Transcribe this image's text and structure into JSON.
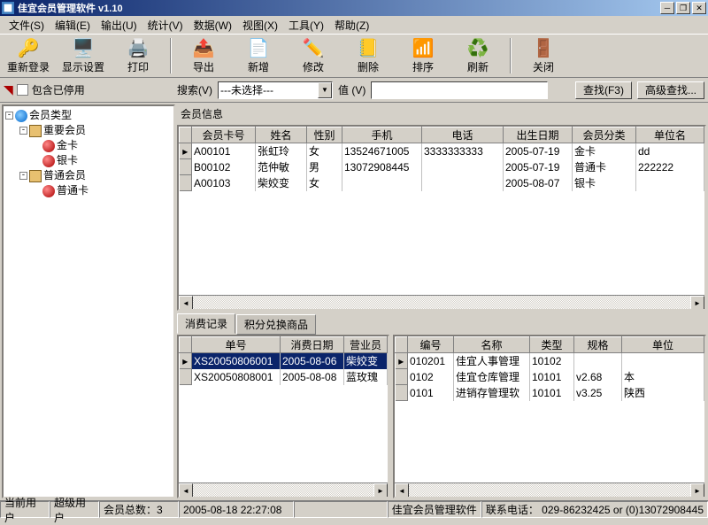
{
  "title": "佳宜会员管理软件 v1.10",
  "menu": [
    "文件(S)",
    "编辑(E)",
    "输出(U)",
    "统计(V)",
    "数据(W)",
    "视图(X)",
    "工具(Y)",
    "帮助(Z)"
  ],
  "toolbar": [
    {
      "label": "重新登录",
      "icon": "🔑"
    },
    {
      "label": "显示设置",
      "icon": "🖥️"
    },
    {
      "label": "打印",
      "icon": "🖨️"
    },
    {
      "label": "导出",
      "icon": "📤"
    },
    {
      "label": "新增",
      "icon": "📄"
    },
    {
      "label": "修改",
      "icon": "✏️"
    },
    {
      "label": "删除",
      "icon": "📒"
    },
    {
      "label": "排序",
      "icon": "📶"
    },
    {
      "label": "刷新",
      "icon": "♻️"
    },
    {
      "label": "关闭",
      "icon": "🚪"
    }
  ],
  "searchbar": {
    "stopped_label": "包含已停用",
    "search_label": "搜索(V)",
    "combo_value": "---未选择---",
    "value_label": "值 (V)",
    "find_btn": "查找(F3)",
    "adv_btn": "高级查找..."
  },
  "tree": {
    "root": "会员类型",
    "n1": "重要会员",
    "n1a": "金卡",
    "n1b": "银卡",
    "n2": "普通会员",
    "n2a": "普通卡"
  },
  "grid_top": {
    "title": "会员信息",
    "cols": [
      "会员卡号",
      "姓名",
      "性别",
      "手机",
      "电话",
      "出生日期",
      "会员分类",
      "单位名"
    ],
    "rows": [
      [
        "A00101",
        "张虹玲",
        "女",
        "13524671005",
        "3333333333",
        "2005-07-19",
        "金卡",
        "dd"
      ],
      [
        "B00102",
        "范仲敏",
        "男",
        "13072908445",
        "",
        "2005-07-19",
        "普通卡",
        "222222"
      ],
      [
        "A00103",
        "柴姣变",
        "女",
        "",
        "",
        "2005-08-07",
        "银卡",
        ""
      ]
    ]
  },
  "tabs": [
    "消费记录",
    "积分兑换商品"
  ],
  "grid_bl": {
    "cols": [
      "单号",
      "消费日期",
      "营业员"
    ],
    "rows": [
      [
        "XS20050806001",
        "2005-08-06",
        "柴姣变"
      ],
      [
        "XS20050808001",
        "2005-08-08",
        "蓝玫瑰"
      ]
    ]
  },
  "grid_br": {
    "cols": [
      "编号",
      "名称",
      "类型",
      "规格",
      "单位"
    ],
    "rows": [
      [
        "010201",
        "佳宜人事管理",
        "10102",
        "",
        ""
      ],
      [
        "0102",
        "佳宜仓库管理",
        "10101",
        "v2.68",
        "本"
      ],
      [
        "0101",
        "进销存管理软",
        "10101",
        "v3.25",
        "陕西"
      ]
    ]
  },
  "status": {
    "s1": "当前用户",
    "s2": "超级用户",
    "s3": "会员总数：3",
    "s4": "2005-08-18 22:27:08",
    "s5": "佳宜会员管理软件",
    "s6": "联系电话：",
    "s7": "029-86232425 or (0)13072908445"
  }
}
